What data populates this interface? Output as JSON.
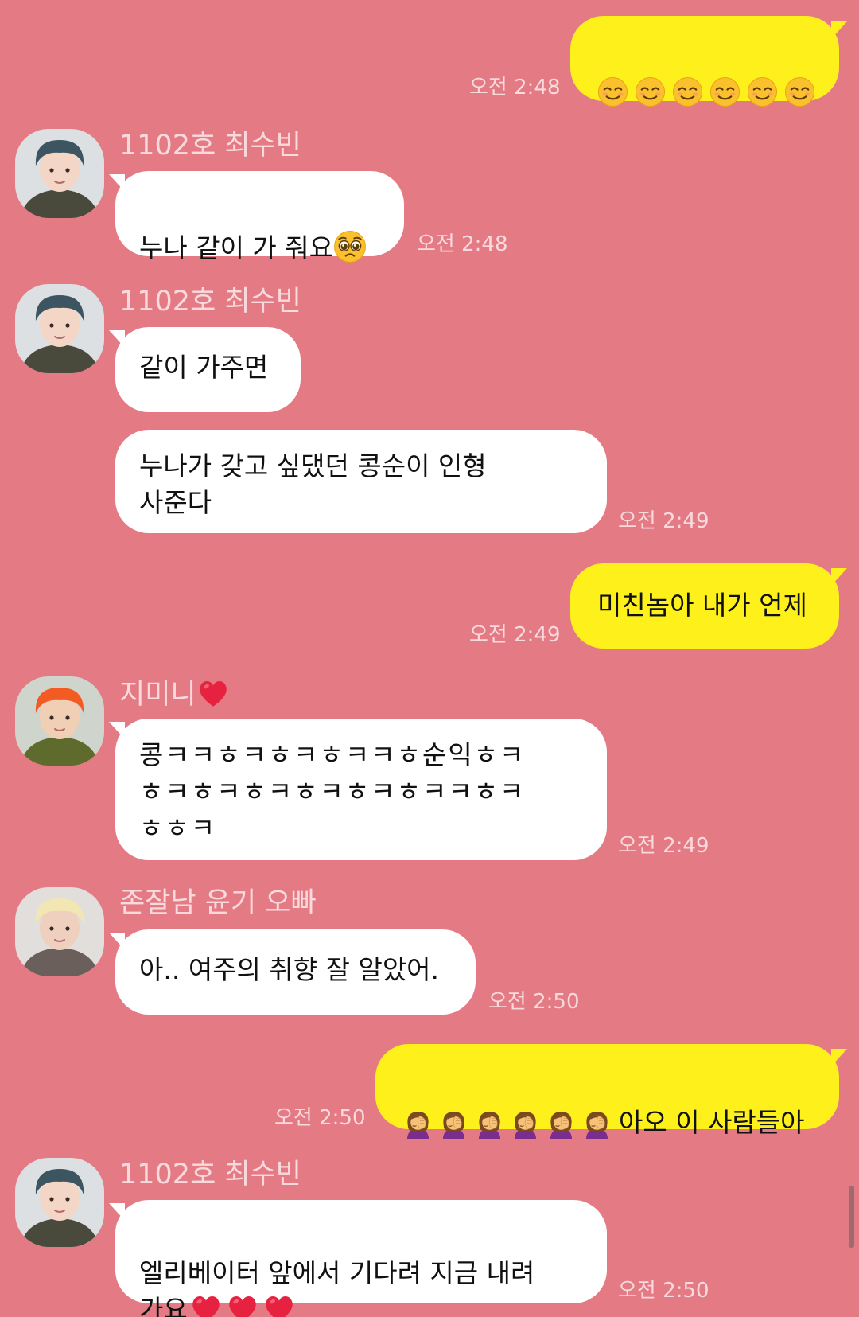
{
  "theme": {
    "background": "#e47a84",
    "incoming_bubble": "#ffffff",
    "outgoing_bubble": "#fef01b"
  },
  "icons": {
    "smile_emoji": "smiling-face-emoji",
    "pleading_emoji": "pleading-face-emoji",
    "heart_emoji": "red-heart-emoji",
    "facepalm_emoji": "woman-facepalming-emoji"
  },
  "messages": [
    {
      "id": "m1",
      "side": "out",
      "content": "😌😌😌😌😌😌",
      "time": "오전 2:48"
    },
    {
      "id": "m2",
      "side": "in",
      "sender": "1102호 최수빈",
      "content": "누나 같이 가 줘요🥺",
      "time": "오전 2:48"
    },
    {
      "id": "m3",
      "side": "in",
      "sender": "1102호 최수빈",
      "content": "같이 가주면"
    },
    {
      "id": "m4",
      "side": "in",
      "content": "누나가 갖고 싶댔던 콩순이 인형\n사준다",
      "time": "오전 2:49"
    },
    {
      "id": "m5",
      "side": "out",
      "content": "미친놈아 내가 언제",
      "time": "오전 2:49"
    },
    {
      "id": "m6",
      "side": "in",
      "sender": "지미니❤️",
      "sender_text": "지미니",
      "content": "콩ㅋㅋㅎㅋㅎㅋㅎㅋㅋㅎ순익ㅎㅋ\nㅎㅋㅎㅋㅎㅋㅎㅋㅎㅋㅎㅋㅋㅎㅋ\nㅎㅎㅋ",
      "time": "오전 2:49"
    },
    {
      "id": "m7",
      "side": "in",
      "sender": "존잘남 윤기 오빠",
      "content": "아.. 여주의 취향 잘 알았어.",
      "time": "오전 2:50"
    },
    {
      "id": "m8",
      "side": "out",
      "content": "🤦‍♀️🤦‍♀️🤦‍♀️🤦‍♀️🤦‍♀️🤦‍♀️아오 이 사람들아",
      "content_text": "아오 이 사람들아",
      "time": "오전 2:50"
    },
    {
      "id": "m9",
      "side": "in",
      "sender": "1102호 최수빈",
      "content": "엘리베이터 앞에서 기다려 지금 내려\n가요❤️❤️❤️",
      "content_text": "엘리베이터 앞에서 기다려 지금 내려\n가요",
      "time": "오전 2:50"
    }
  ]
}
